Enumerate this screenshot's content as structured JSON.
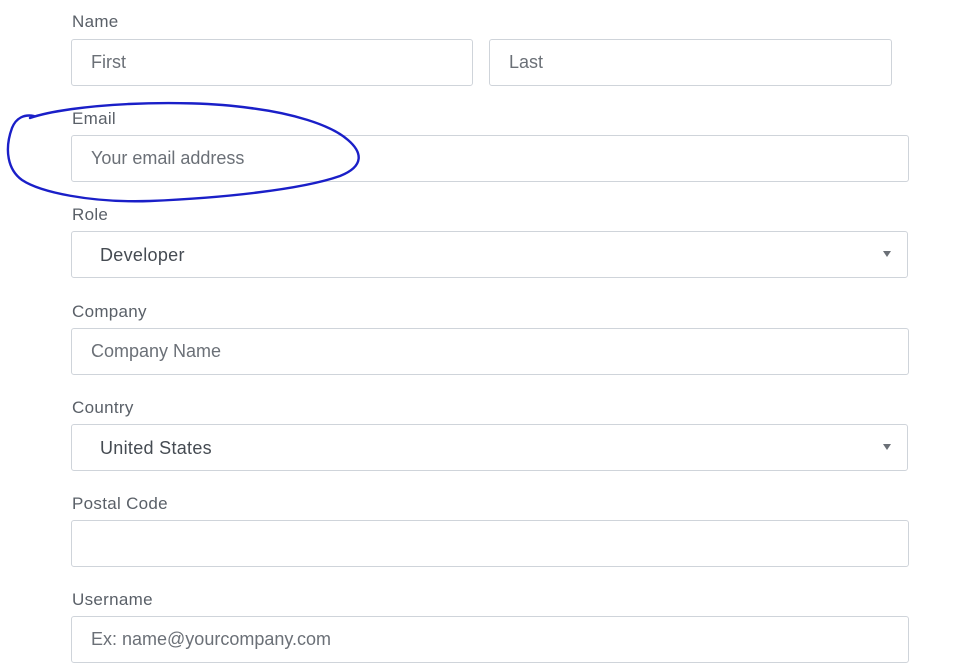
{
  "form": {
    "name": {
      "label": "Name",
      "first_placeholder": "First",
      "last_placeholder": "Last"
    },
    "email": {
      "label": "Email",
      "placeholder": "Your email address"
    },
    "role": {
      "label": "Role",
      "selected": "Developer"
    },
    "company": {
      "label": "Company",
      "placeholder": "Company Name"
    },
    "country": {
      "label": "Country",
      "selected": "United States"
    },
    "postal_code": {
      "label": "Postal Code",
      "value": ""
    },
    "username": {
      "label": "Username",
      "placeholder": "Ex: name@yourcompany.com"
    }
  },
  "annotation": {
    "color": "#1a1fc8",
    "icon": "hand-drawn-circle"
  }
}
